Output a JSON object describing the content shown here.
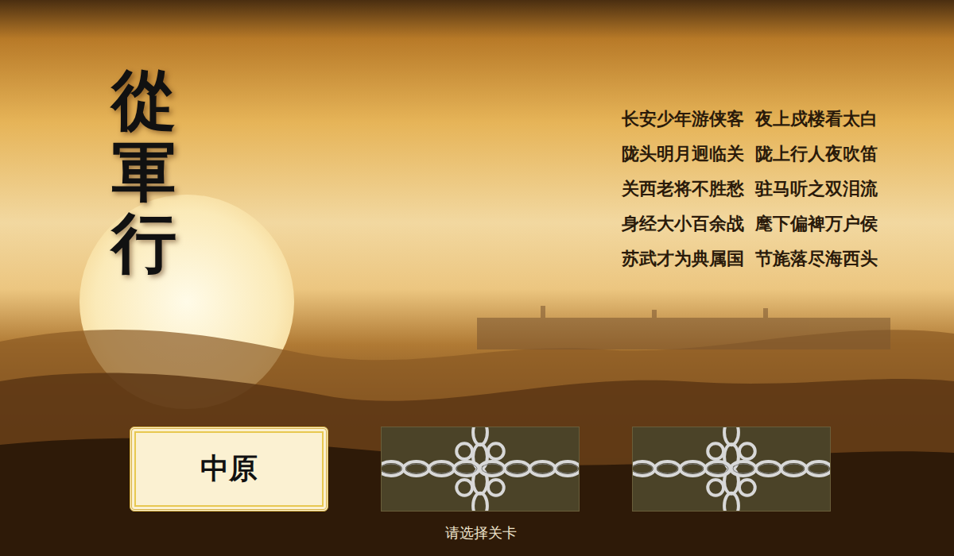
{
  "title": "從軍行",
  "poem": [
    {
      "first": "长安少年游侠客",
      "second": "夜上戍楼看太白"
    },
    {
      "first": "陇头明月迥临关",
      "second": "陇上行人夜吹笛"
    },
    {
      "first": "关西老将不胜愁",
      "second": "驻马听之双泪流"
    },
    {
      "first": "身经大小百余战",
      "second": "麾下偏裨万户侯"
    },
    {
      "first": "苏武才为典属国",
      "second": "节旄落尽海西头"
    }
  ],
  "levels": [
    {
      "name": "中原",
      "locked": false,
      "selected": true
    },
    {
      "locked": true,
      "selected": false
    },
    {
      "locked": true,
      "selected": false
    }
  ],
  "hint": "请选择关卡"
}
